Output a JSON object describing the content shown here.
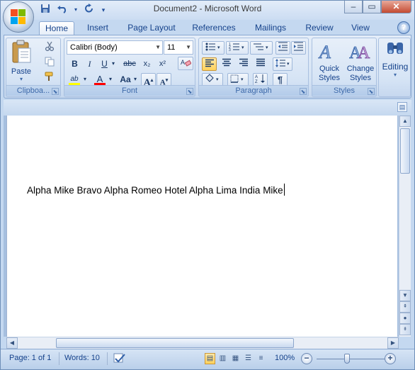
{
  "title": "Document2 - Microsoft Word",
  "window_controls": {
    "minimize": "–",
    "maximize": "▭",
    "close": "✕"
  },
  "quick_access": [
    {
      "icon": "save-icon",
      "glyph": "💾"
    },
    {
      "icon": "undo-icon",
      "glyph": "↶"
    },
    {
      "icon": "redo-icon",
      "glyph": "↻"
    },
    {
      "icon": "customize-icon",
      "glyph": "▾"
    }
  ],
  "tabs": [
    "Home",
    "Insert",
    "Page Layout",
    "References",
    "Mailings",
    "Review",
    "View"
  ],
  "active_tab": "Home",
  "help_glyph": "?",
  "ribbon": {
    "clipboard": {
      "label": "Clipboa...",
      "paste": "Paste"
    },
    "font": {
      "label": "Font",
      "font_name": "Calibri (Body)",
      "font_size": "11",
      "bold": "B",
      "italic": "I",
      "underline": "U",
      "strike": "abc",
      "subscript": "x₂",
      "superscript": "x²",
      "grow": "A",
      "shrink": "A",
      "case": "Aa",
      "highlight": "ab",
      "font_color": "A",
      "clear": "Aᵦ"
    },
    "paragraph": {
      "label": "Paragraph",
      "pilcrow": "¶"
    },
    "styles": {
      "label": "Styles",
      "quick_styles": "Quick Styles",
      "change_styles": "Change Styles"
    },
    "editing": {
      "label": "Editing"
    }
  },
  "document": {
    "text": "Alpha Mike Bravo Alpha Romeo Hotel Alpha Lima India Mike"
  },
  "status": {
    "page": "Page: 1 of 1",
    "words": "Words: 10",
    "zoom": "100%"
  },
  "colors": {
    "accent": "#15428b",
    "highlight": "#ffff00",
    "font_color": "#ff0000"
  }
}
